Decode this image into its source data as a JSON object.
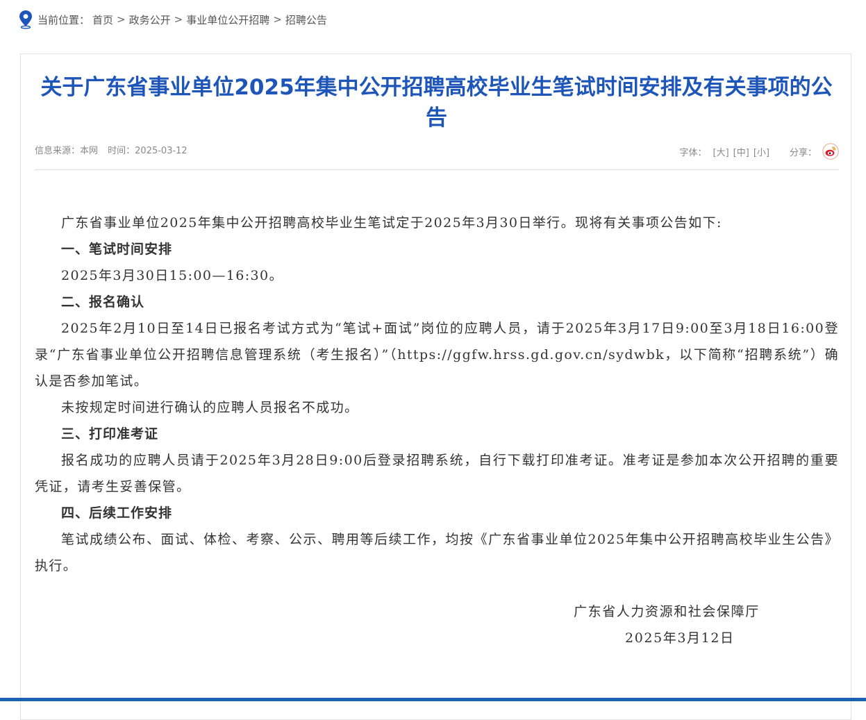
{
  "breadcrumb": {
    "label": "当前位置",
    "colon": "：",
    "separator": ">",
    "items": [
      "首页",
      "政务公开",
      "事业单位公开招聘",
      "招聘公告"
    ]
  },
  "article": {
    "title": "关于广东省事业单位2025年集中公开招聘高校毕业生笔试时间安排及有关事项的公告",
    "source": "信息来源：本网",
    "time": "时间：2025-03-12",
    "font_size_label": "字体：",
    "font_sizes": [
      "[大]",
      "[中]",
      "[小]"
    ],
    "share_label": "分享：",
    "paragraphs": [
      {
        "heading": false,
        "text": "广东省事业单位2025年集中公开招聘高校毕业生笔试定于2025年3月30日举行。现将有关事项公告如下:"
      },
      {
        "heading": true,
        "text": "一、笔试时间安排"
      },
      {
        "heading": false,
        "text": "2025年3月30日15:00—16:30。"
      },
      {
        "heading": true,
        "text": "二、报名确认"
      },
      {
        "heading": false,
        "text": "2025年2月10日至14日已报名考试方式为“笔试+面试”岗位的应聘人员，请于2025年3月17日9:00至3月18日16:00登录“广东省事业单位公开招聘信息管理系统（考生报名）”（https://ggfw.hrss.gd.gov.cn/sydwbk，以下简称“招聘系统”）确认是否参加笔试。"
      },
      {
        "heading": false,
        "text": "未按规定时间进行确认的应聘人员报名不成功。"
      },
      {
        "heading": true,
        "text": "三、打印准考证"
      },
      {
        "heading": false,
        "text": "报名成功的应聘人员请于2025年3月28日9:00后登录招聘系统，自行下载打印准考证。准考证是参加本次公开招聘的重要凭证，请考生妥善保管。"
      },
      {
        "heading": true,
        "text": "四、后续工作安排"
      },
      {
        "heading": false,
        "text": "笔试成绩公布、面试、体检、考察、公示、聘用等后续工作，均按《广东省事业单位2025年集中公开招聘高校毕业生公告》执行。"
      }
    ],
    "signature_org": "广东省人力资源和社会保障厅",
    "signature_date": "2025年3月12日"
  },
  "icons": {
    "location": "location-pin-icon",
    "share_weibo": "weibo-icon"
  },
  "colors": {
    "title": "#1d56b8",
    "pin": "#1d56b8",
    "weibo": "#e6162d",
    "bottom_strip": "#1b63b0"
  }
}
